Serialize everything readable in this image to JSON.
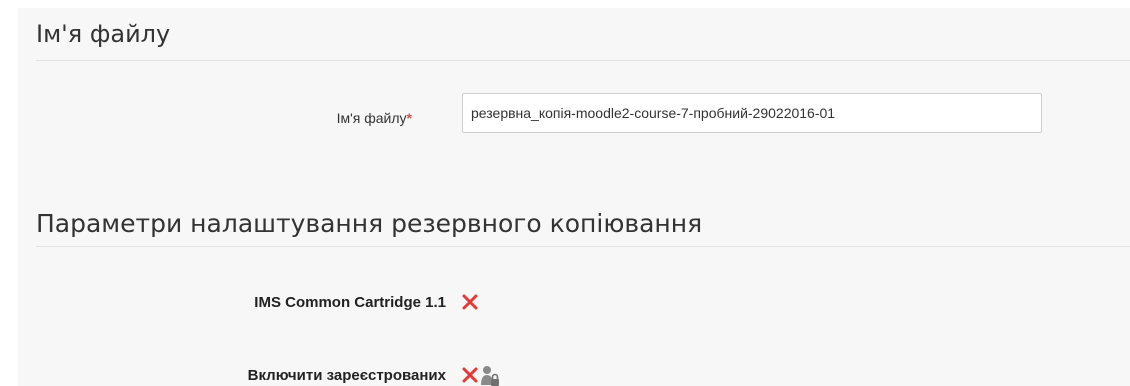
{
  "filename_section": {
    "title": "Ім'я файлу",
    "field_label": "Ім'я файлу",
    "required_mark": "*",
    "field_value": "резервна_копія-moodle2-course-7-пробний-29022016-01"
  },
  "backup_settings_section": {
    "title": "Параметри налаштування резервного копіювання",
    "settings": [
      {
        "label": "IMS Common Cartridge 1.1",
        "status_icon": "red-x-icon",
        "locked": false
      },
      {
        "label": "Включити зареєстрованих",
        "status_icon": "red-x-icon",
        "locked": true,
        "lock_icon": "user-lock-icon"
      }
    ]
  },
  "colors": {
    "panel_background": "#f7f7f7",
    "required_mark": "#d9534f",
    "status_no": "#e53935",
    "lock_icon": "#8a8a8a"
  }
}
